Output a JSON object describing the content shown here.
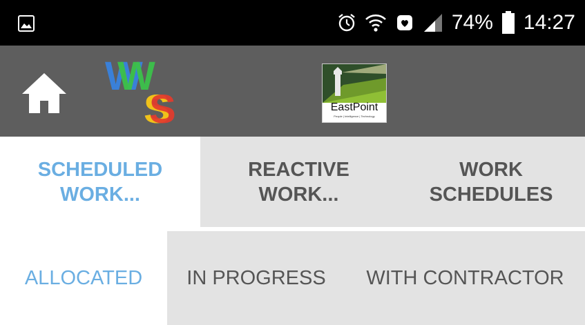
{
  "status_bar": {
    "battery_percent": "74%",
    "time": "14:27",
    "icons": [
      "image-icon",
      "alarm-icon",
      "wifi-icon",
      "notification-icon",
      "signal-icon",
      "battery-icon"
    ]
  },
  "app_bar": {
    "home_icon": "home-icon",
    "app_logo_text": "WS",
    "company_logo_text": "EastPoint",
    "company_logo_tagline": "People | Intelligence | Technology"
  },
  "primary_tabs": [
    {
      "label": "SCHEDULED WORK...",
      "line1": "SCHEDULED",
      "line2": "WORK...",
      "active": true
    },
    {
      "label": "REACTIVE WORK...",
      "line1": "REACTIVE",
      "line2": "WORK...",
      "active": false
    },
    {
      "label": "WORK SCHEDULES",
      "line1": "WORK",
      "line2": "SCHEDULES",
      "active": false
    }
  ],
  "secondary_tabs": [
    {
      "label": "ALLOCATED",
      "active": true
    },
    {
      "label": "IN PROGRESS",
      "active": false
    },
    {
      "label": "WITH CONTRACTOR",
      "active": false
    }
  ],
  "colors": {
    "status_bar_bg": "#000000",
    "app_bar_bg": "#5e5e5e",
    "active_tab_text": "#6aaee2",
    "inactive_tab_text": "#555555",
    "inactive_tab_bg": "#e3e3e3"
  }
}
